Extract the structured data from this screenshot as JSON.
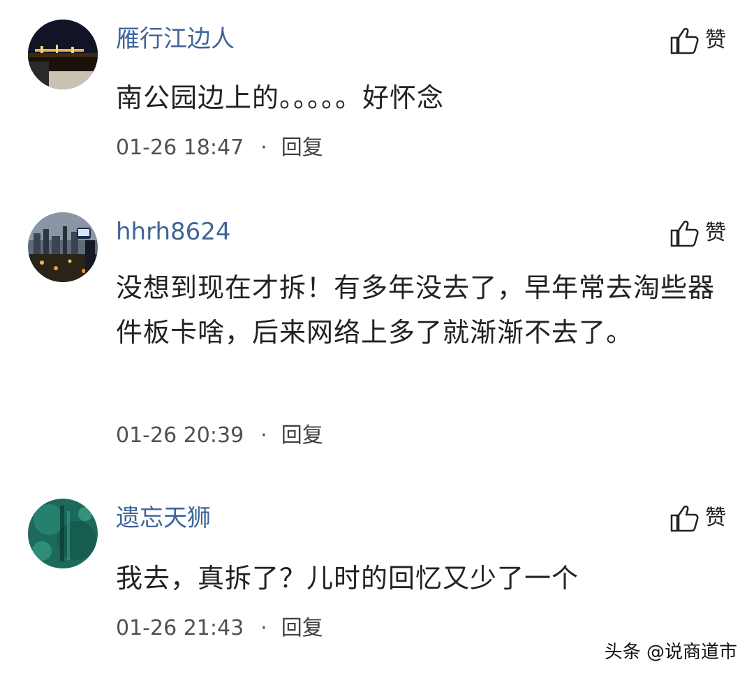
{
  "comments": [
    {
      "username": "雁行江边人",
      "like_label": "赞",
      "avatar_icon": "night-city-avatar",
      "text": "南公园边上的。。。。。好怀念",
      "timestamp": "01-26 18:47",
      "separator": "·",
      "reply_label": "回复"
    },
    {
      "username": "hhrh8624",
      "like_label": "赞",
      "avatar_icon": "city-skyline-avatar",
      "text": "没想到现在才拆！有多年没去了，早年常去淘些器件板卡啥，后来网络上多了就渐渐不去了。",
      "timestamp": "01-26 20:39",
      "separator": "·",
      "reply_label": "回复"
    },
    {
      "username": "遗忘天狮",
      "like_label": "赞",
      "avatar_icon": "green-pattern-avatar",
      "text": "我去，真拆了？儿时的回忆又少了一个",
      "timestamp": "01-26 21:43",
      "separator": "·",
      "reply_label": "回复"
    }
  ],
  "like_icon": "thumbs-up-icon",
  "watermark": "头条 @说商道市",
  "colors": {
    "username": "#406599",
    "body_text": "#222222",
    "meta_text": "#505050",
    "background": "#ffffff"
  }
}
